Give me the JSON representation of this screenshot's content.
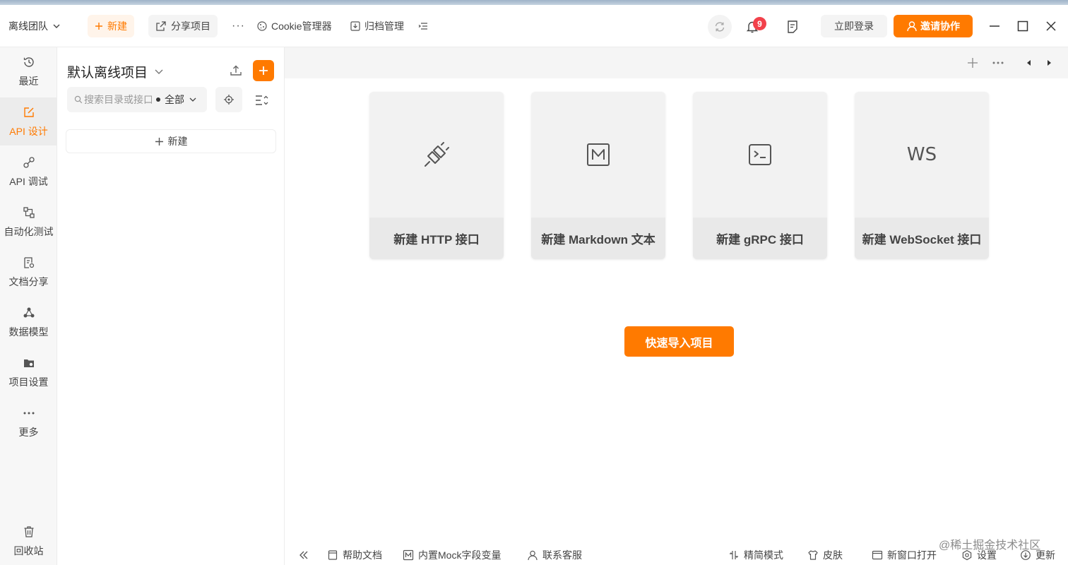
{
  "topbar": {
    "team_name": "离线团队",
    "new_label": "新建",
    "share_label": "分享项目",
    "more_label": "···",
    "cookie_label": "Cookie管理器",
    "archive_label": "归档管理",
    "notification_count": "9",
    "login_label": "立即登录",
    "invite_label": "邀请协作"
  },
  "nav": {
    "items": [
      {
        "label": "最近",
        "icon": "clock-icon"
      },
      {
        "label": "API 设计",
        "icon": "edit-icon"
      },
      {
        "label": "API 调试",
        "icon": "link-icon"
      },
      {
        "label": "自动化测试",
        "icon": "flow-icon"
      },
      {
        "label": "文档分享",
        "icon": "doc-icon"
      },
      {
        "label": "数据模型",
        "icon": "model-icon"
      },
      {
        "label": "项目设置",
        "icon": "folder-settings-icon"
      },
      {
        "label": "更多",
        "icon": "more-icon"
      }
    ],
    "trash_label": "回收站"
  },
  "panel": {
    "project_title": "默认离线项目",
    "search_placeholder": "搜索目录或接口",
    "filter_label": "全部",
    "new_label": "新建"
  },
  "main": {
    "cards": [
      {
        "label": "新建 HTTP 接口",
        "icon": "plug-icon"
      },
      {
        "label": "新建 Markdown 文本",
        "icon": "markdown-icon"
      },
      {
        "label": "新建 gRPC 接口",
        "icon": "terminal-icon"
      },
      {
        "label": "新建 WebSocket 接口",
        "icon": "ws-icon",
        "icon_text": "WS"
      }
    ],
    "import_label": "快速导入项目"
  },
  "statusbar": {
    "help_label": "帮助文档",
    "mock_label": "内置Mock字段变量",
    "support_label": "联系客服",
    "compact_label": "精简模式",
    "skin_label": "皮肤",
    "new_window_label": "新窗口打开",
    "settings_label": "设置",
    "update_label": "更新"
  },
  "watermark": "@稀土掘金技术社区",
  "colors": {
    "accent": "#ff7a00",
    "badge": "#f2414b"
  }
}
